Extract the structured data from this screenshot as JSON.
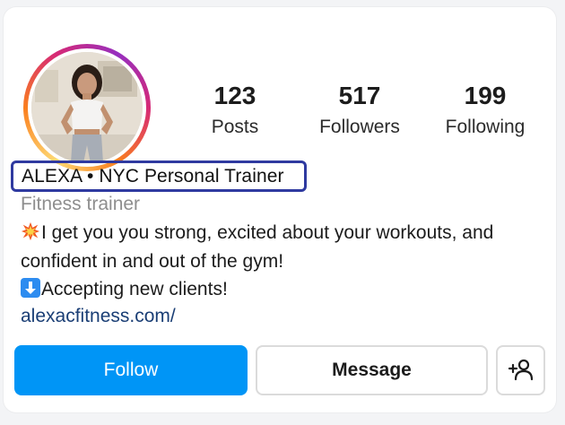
{
  "profile": {
    "name": "ALEXA • NYC Personal Trainer",
    "category": "Fitness trainer",
    "bio_lines": [
      "I get you you strong, excited about your workouts, and",
      "confident in and out of the gym!",
      "Accepting new clients!"
    ],
    "website": "alexacfitness.com/"
  },
  "stats": {
    "posts": {
      "value": "123",
      "label": "Posts"
    },
    "followers": {
      "value": "517",
      "label": "Followers"
    },
    "following": {
      "value": "199",
      "label": "Following"
    }
  },
  "actions": {
    "follow_label": "Follow",
    "message_label": "Message",
    "add_user_icon": "add-user-icon"
  },
  "icons": {
    "burst": "collision-emoji-icon",
    "down": "down-arrow-emoji-icon"
  },
  "colors": {
    "follow_button": "#0095f6",
    "name_highlight": "#2f3aa0",
    "link": "#1a3e75",
    "secondary_text": "#8e8e8e"
  }
}
